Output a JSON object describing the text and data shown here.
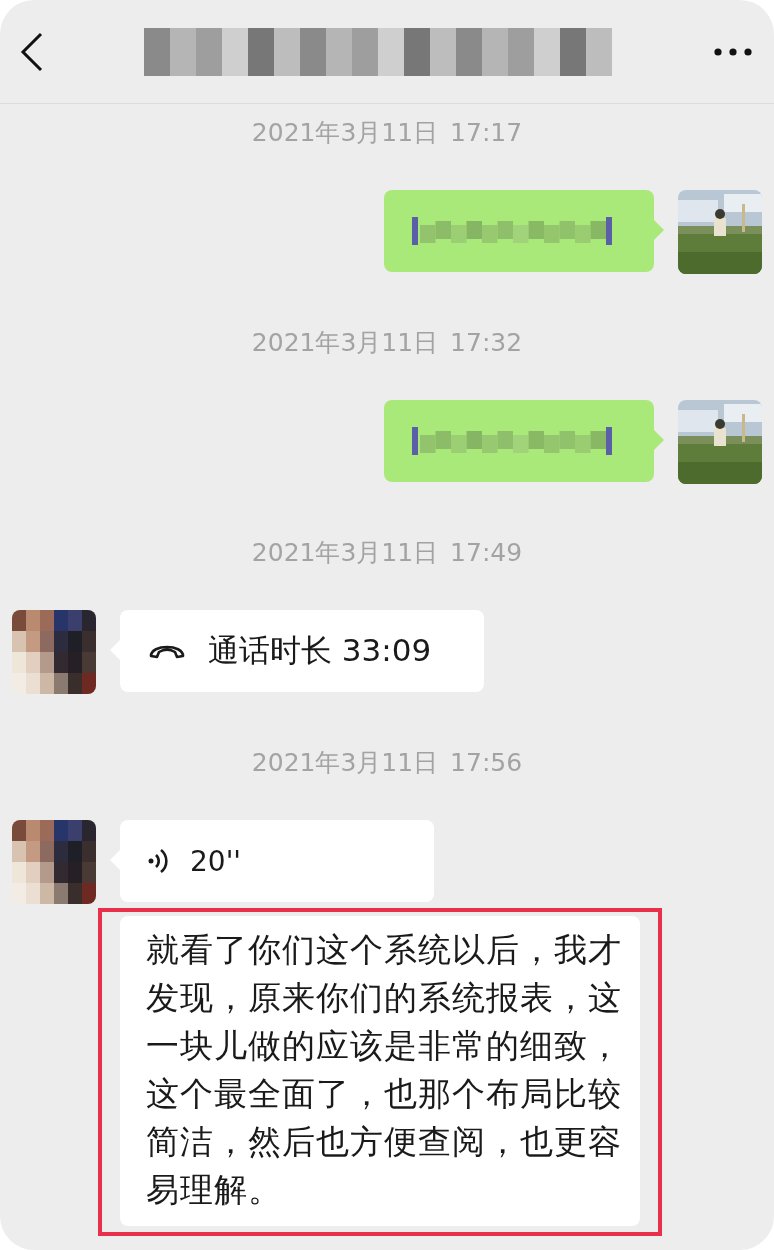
{
  "messages": [
    {
      "kind": "timestamp",
      "text": "2021年3月11日 17:17"
    },
    {
      "kind": "redacted",
      "outgoing": true
    },
    {
      "kind": "timestamp",
      "text": "2021年3月11日 17:32"
    },
    {
      "kind": "redacted",
      "outgoing": true
    },
    {
      "kind": "timestamp",
      "text": "2021年3月11日 17:49"
    },
    {
      "kind": "call",
      "outgoing": false,
      "text": "通话时长 33:09"
    },
    {
      "kind": "timestamp",
      "text": "2021年3月11日 17:56"
    },
    {
      "kind": "voice",
      "outgoing": false,
      "duration": "20''",
      "transcript": "就看了你们这个系统以后，我才发现，原来你们的系统报表，这一块儿做的应该是非常的细致，这个最全面了，也那个布局比较简洁，然后也方便查阅，也更容易理解。",
      "highlighted": true
    }
  ]
}
